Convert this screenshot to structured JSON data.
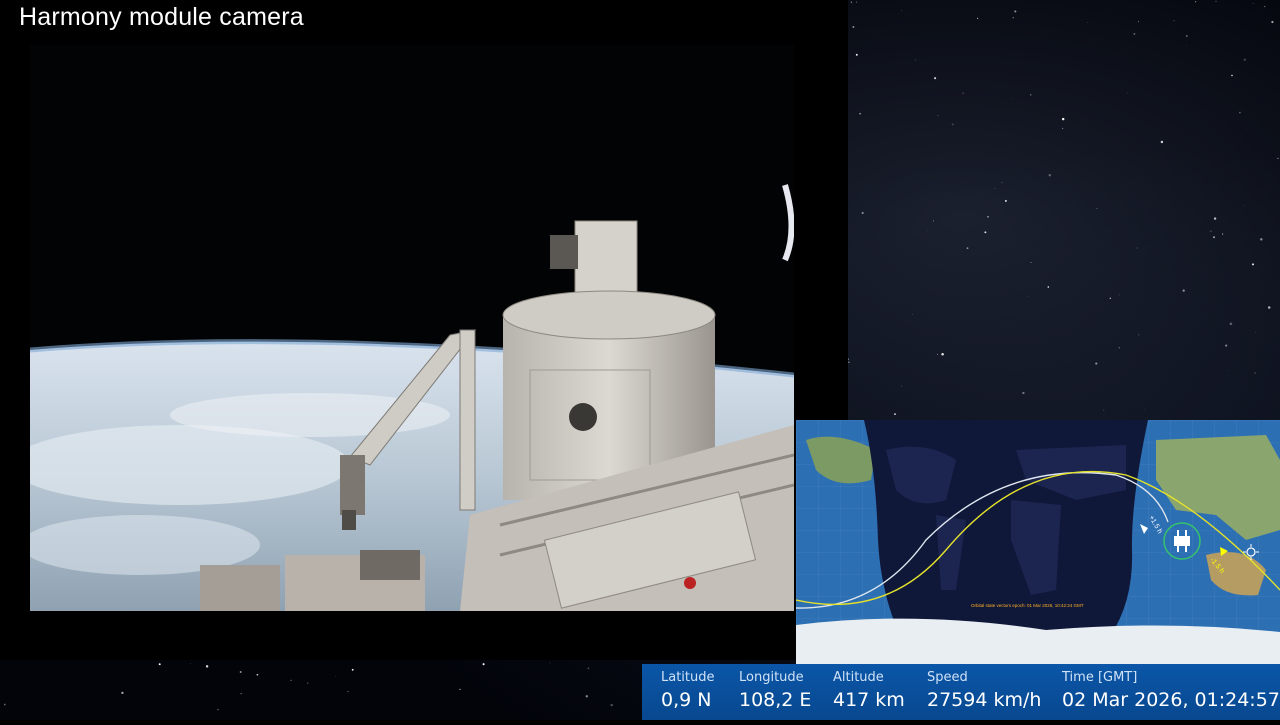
{
  "header": {
    "title": "Harmony module camera"
  },
  "map": {
    "epoch_text": "Orbital state vectors epoch: 01 Mar 2026, 10:42:24 GMT",
    "marker_ahead": "+1.5 h",
    "marker_behind": "-1.5 h"
  },
  "telemetry": [
    {
      "label": "Latitude",
      "value": "0,9 N"
    },
    {
      "label": "Longitude",
      "value": "108,2 E"
    },
    {
      "label": "Altitude",
      "value": "417 km"
    },
    {
      "label": "Speed",
      "value": "27594 km/h"
    },
    {
      "label": "Time [GMT]",
      "value": "02 Mar 2026, 01:24:57"
    }
  ],
  "icons": [
    "iss-icon",
    "sun-icon"
  ],
  "colors": {
    "telemetry_bg": "#0b56a8",
    "orbit_white": "#dfe6ee",
    "orbit_yellow": "#e3e12b"
  }
}
